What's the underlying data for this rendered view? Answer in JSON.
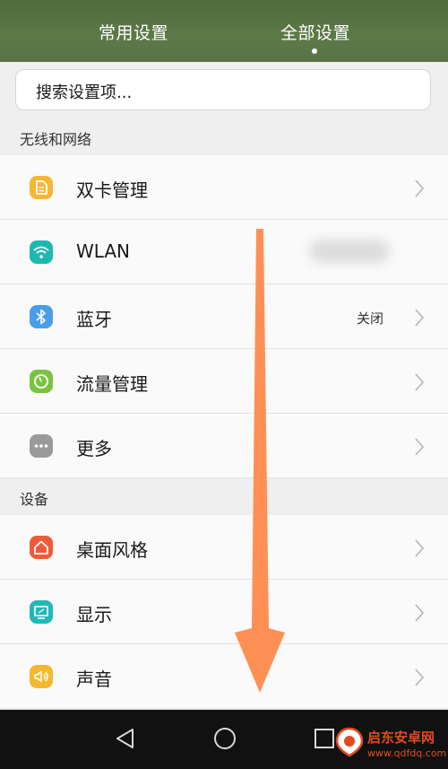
{
  "tabs": {
    "common": "常用设置",
    "all": "全部设置"
  },
  "search": {
    "placeholder": "搜索设置项..."
  },
  "sections": {
    "wireless": "无线和网络",
    "device": "设备"
  },
  "rows": [
    {
      "label": "双卡管理",
      "value": "",
      "icon": "sim-card-icon",
      "color": "#f7b733"
    },
    {
      "label": "WLAN",
      "value": "",
      "icon": "wifi-icon",
      "color": "#1fb8b0"
    },
    {
      "label": "蓝牙",
      "value": "关闭",
      "icon": "bluetooth-icon",
      "color": "#4a9ee8"
    },
    {
      "label": "流量管理",
      "value": "",
      "icon": "data-usage-icon",
      "color": "#7cc242"
    },
    {
      "label": "更多",
      "value": "",
      "icon": "more-icon",
      "color": "#9a9a9a"
    },
    {
      "label": "桌面风格",
      "value": "",
      "icon": "home-icon",
      "color": "#f05a3a"
    },
    {
      "label": "显示",
      "value": "",
      "icon": "display-icon",
      "color": "#22b8b8"
    },
    {
      "label": "声音",
      "value": "",
      "icon": "sound-icon",
      "color": "#f4b82e"
    }
  ],
  "watermark": {
    "title": "启东安卓网",
    "url": "www.qdfdq.com"
  },
  "colors": {
    "header_green": "#587443",
    "arrow_orange": "#ff8a4c"
  }
}
